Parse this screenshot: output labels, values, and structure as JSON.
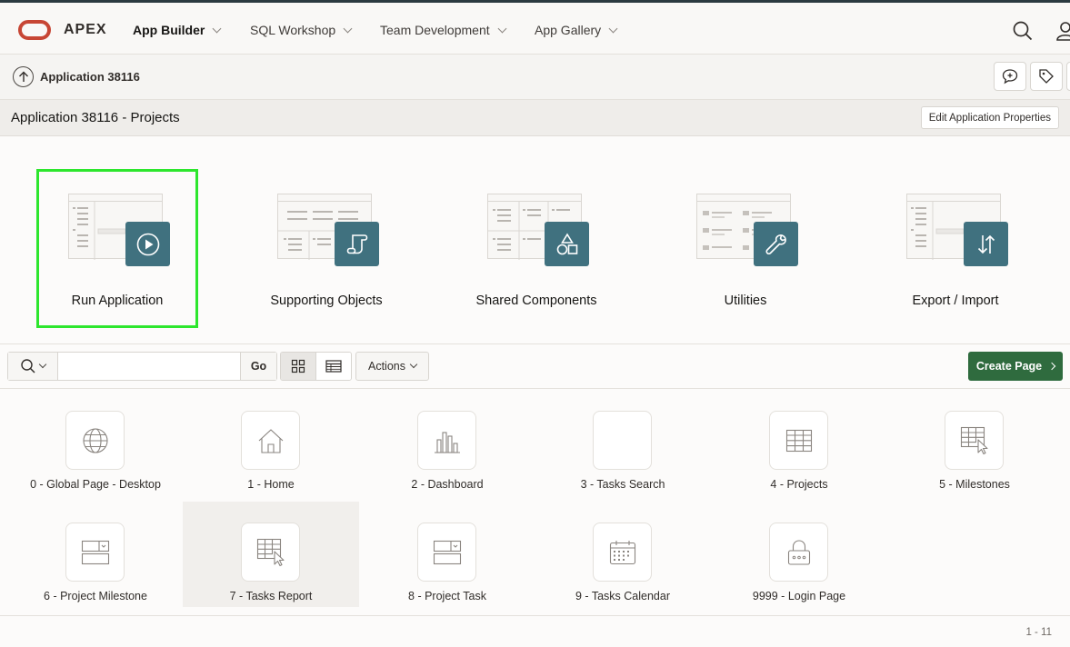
{
  "topnav": {
    "brand": "APEX",
    "items": [
      "App Builder",
      "SQL Workshop",
      "Team Development",
      "App Gallery"
    ],
    "active_index": 0,
    "logo_color": "#c74634"
  },
  "breadcrumb": {
    "label": "Application 38116"
  },
  "titlebar": {
    "title": "Application 38116 - Projects",
    "edit_button": "Edit Application Properties"
  },
  "hero_cards": [
    {
      "label": "Run Application",
      "icon": "play-icon",
      "selected": true
    },
    {
      "label": "Supporting Objects",
      "icon": "scroll-icon",
      "selected": false
    },
    {
      "label": "Shared Components",
      "icon": "shapes-icon",
      "selected": false
    },
    {
      "label": "Utilities",
      "icon": "wrench-icon",
      "selected": false
    },
    {
      "label": "Export / Import",
      "icon": "arrows-updown-icon",
      "selected": false
    }
  ],
  "toolbar": {
    "search_value": "",
    "go_label": "Go",
    "actions_label": "Actions",
    "create_label": "Create Page",
    "create_color": "#2f6b3e"
  },
  "pages": [
    {
      "label": "0 - Global Page - Desktop",
      "icon": "globe-icon"
    },
    {
      "label": "1 - Home",
      "icon": "home-icon"
    },
    {
      "label": "2 - Dashboard",
      "icon": "bar-chart-icon"
    },
    {
      "label": "3 - Tasks Search",
      "icon": "blank-icon"
    },
    {
      "label": "4 - Projects",
      "icon": "table-icon"
    },
    {
      "label": "5 - Milestones",
      "icon": "table-cursor-icon"
    },
    {
      "label": "6 - Project Milestone",
      "icon": "form-icon"
    },
    {
      "label": "7 - Tasks Report",
      "icon": "table-cursor-icon"
    },
    {
      "label": "8 - Project Task",
      "icon": "form-icon"
    },
    {
      "label": "9 - Tasks Calendar",
      "icon": "calendar-icon"
    },
    {
      "label": "9999 - Login Page",
      "icon": "lock-icon"
    }
  ],
  "footer": {
    "pagination": "1 - 11"
  },
  "accent_color": "#40717f",
  "selection_color": "#2de62d"
}
